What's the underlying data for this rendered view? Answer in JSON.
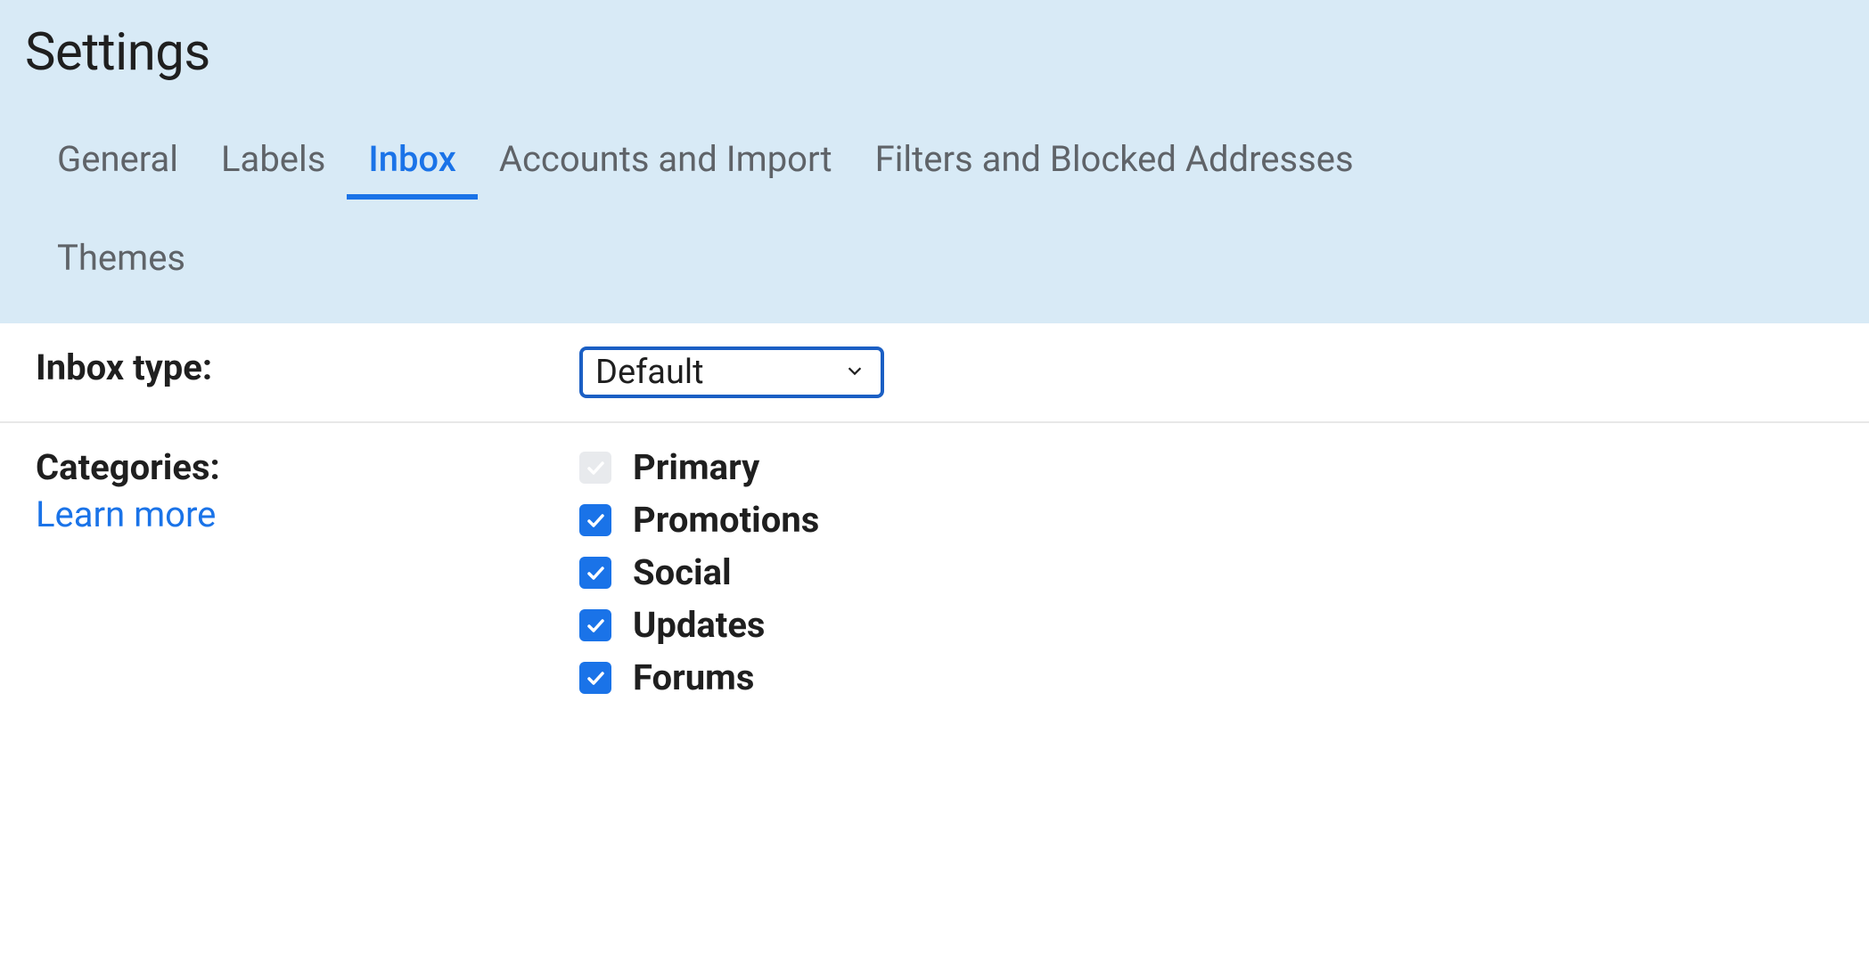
{
  "title": "Settings",
  "tabs": [
    {
      "label": "General",
      "active": false
    },
    {
      "label": "Labels",
      "active": false
    },
    {
      "label": "Inbox",
      "active": true
    },
    {
      "label": "Accounts and Import",
      "active": false
    },
    {
      "label": "Filters and Blocked Addresses",
      "active": false
    }
  ],
  "tabs_row2": [
    {
      "label": "Themes",
      "active": false
    }
  ],
  "inbox_type": {
    "label": "Inbox type:",
    "selected": "Default"
  },
  "categories": {
    "label": "Categories:",
    "learn_more": "Learn more",
    "items": [
      {
        "label": "Primary",
        "checked": true,
        "disabled": true
      },
      {
        "label": "Promotions",
        "checked": true,
        "disabled": false
      },
      {
        "label": "Social",
        "checked": true,
        "disabled": false
      },
      {
        "label": "Updates",
        "checked": true,
        "disabled": false
      },
      {
        "label": "Forums",
        "checked": true,
        "disabled": false
      }
    ]
  }
}
